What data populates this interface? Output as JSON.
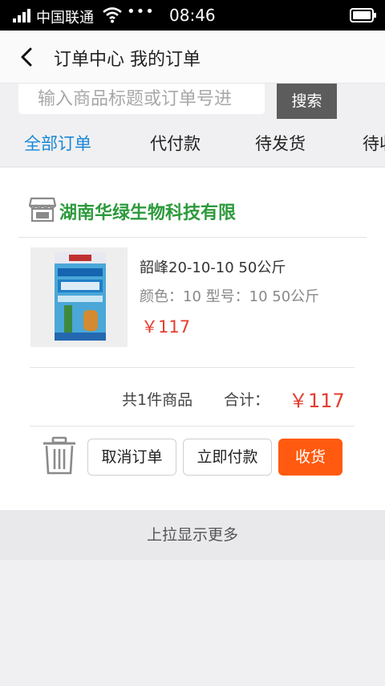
{
  "status_bar": {
    "carrier": "中国联通",
    "dots": "•••",
    "time": "08:46"
  },
  "nav": {
    "title": "订单中心 我的订单"
  },
  "search": {
    "placeholder": "输入商品标题或订单号进",
    "button_label": "搜索"
  },
  "tabs": [
    {
      "label": "全部订单",
      "active": true
    },
    {
      "label": "代付款",
      "active": false
    },
    {
      "label": "待发货",
      "active": false
    },
    {
      "label": "待收货",
      "active": false
    }
  ],
  "order": {
    "shop_name": "湖南华绿生物科技有限",
    "product": {
      "name": "韶峰20-10-10 50公斤",
      "spec": "颜色：10 型号：10 50公斤",
      "price": "￥117"
    },
    "summary": {
      "count_text": "共1件商品",
      "total_label": "合计：",
      "total_value": "￥117"
    },
    "actions": {
      "cancel": "取消订单",
      "pay": "立即付款",
      "receive": "收货"
    }
  },
  "load_more": "上拉显示更多",
  "colors": {
    "accent_tab": "#1a87d6",
    "shop_green": "#2d9a3c",
    "price_red": "#e53d2f",
    "primary_button": "#ff5a0f",
    "search_button": "#5c5c5c"
  }
}
